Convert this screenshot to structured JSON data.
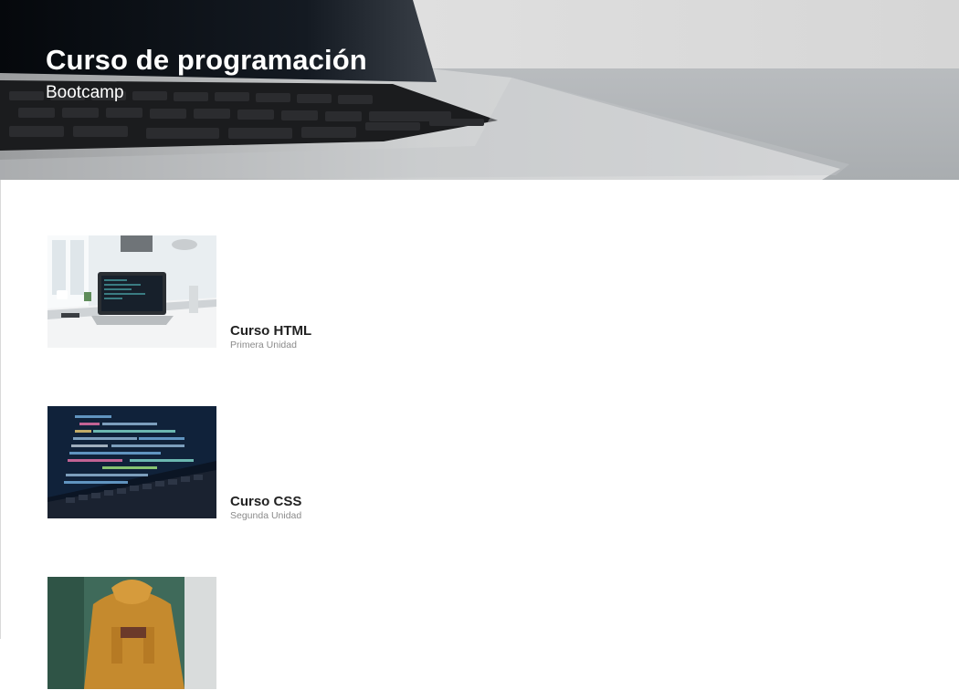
{
  "header": {
    "title": "Curso de programación",
    "subtitle": "Bootcamp"
  },
  "courses": [
    {
      "title": "Curso HTML",
      "subtitle": "Primera Unidad",
      "image": "laptop-desk-photo"
    },
    {
      "title": "Curso CSS",
      "subtitle": "Segunda Unidad",
      "image": "code-screen-photo"
    },
    {
      "title": "",
      "subtitle": "",
      "image": "person-typing-photo"
    }
  ]
}
